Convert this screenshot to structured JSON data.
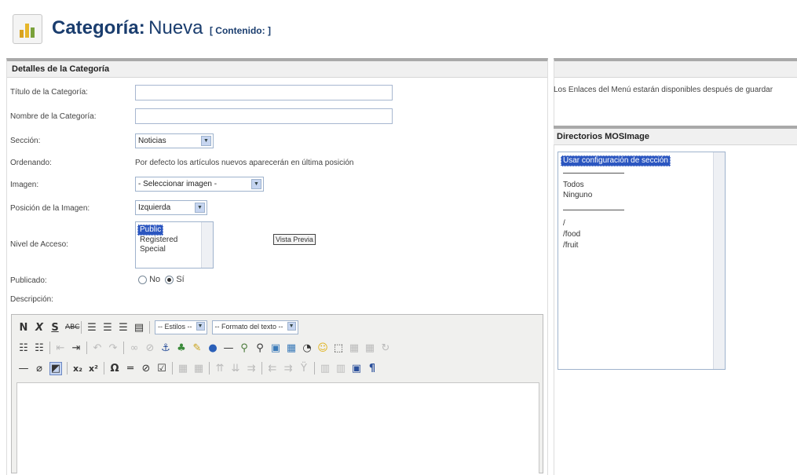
{
  "header": {
    "title_bold": "Categoría:",
    "title_rest": "Nueva",
    "title_context": "[ Contenido: ]",
    "icon": "folder-category-icon"
  },
  "details": {
    "heading": "Detalles de la Categoría",
    "titulo_label": "Título de la Categoría:",
    "titulo_value": "",
    "nombre_label": "Nombre de la Categoría:",
    "nombre_value": "",
    "seccion_label": "Sección:",
    "seccion_value": "Noticias",
    "ordenando_label": "Ordenando:",
    "ordenando_value": "Por defecto los artículos nuevos aparecerán en última posición",
    "imagen_label": "Imagen:",
    "imagen_value": "- Seleccionar imagen -",
    "posicion_label": "Posición de la Imagen:",
    "posicion_value": "Izquierda",
    "nivel_label": "Nivel de Acceso:",
    "nivel_options": [
      "Public",
      "Registered",
      "Special"
    ],
    "nivel_selected": "Public",
    "vista_previa": "Vista Previa",
    "publicado_label": "Publicado:",
    "publicado_no": "No",
    "publicado_si": "Sí",
    "publicado_value": "Sí",
    "descripcion_label": "Descripción:"
  },
  "editor": {
    "estilos": "-- Estilos --",
    "formato": "-- Formato del texto --",
    "row1": [
      "bold-icon",
      "italic-icon",
      "underline-icon",
      "strikethrough-icon",
      "align-left-icon",
      "align-center-icon",
      "align-right-icon",
      "align-justify-icon"
    ],
    "row2_icons": [
      "bullet-list-icon",
      "numbered-list-icon",
      "outdent-icon",
      "indent-icon",
      "undo-icon",
      "redo-icon",
      "link-icon",
      "unlink-icon",
      "anchor-icon",
      "image-icon",
      "cleanup-icon",
      "help-icon",
      "horizontal-rule-icon",
      "find-icon",
      "replace-icon",
      "media-icon",
      "paste-icon",
      "emoticon-icon",
      "smiley-icon",
      "visual-aid-icon",
      "insert-row-icon",
      "delete-row-icon",
      "redo-alt-icon"
    ],
    "row3_icons": [
      "hr-icon",
      "remove-format-icon",
      "visual-aid-icon",
      "subscript-icon",
      "superscript-icon",
      "special-char-icon",
      "insert-line-icon",
      "insert-image-icon",
      "insert-date-icon",
      "table-icon",
      "table-props-icon",
      "row-before-icon",
      "row-after-icon",
      "delete-row-icon",
      "col-before-icon",
      "col-after-icon",
      "delete-col-icon",
      "split-cells-icon",
      "merge-cells-icon",
      "fullscreen-icon",
      "ltr-icon"
    ]
  },
  "right": {
    "menu_note": "Los Enlaces del Menú estarán disponibles después de guardar",
    "mos_heading": "Directorios MOSImage",
    "mos_selected": "Usar configuración de sección",
    "mos_options_group1": [
      "Todos",
      "Ninguno"
    ],
    "mos_options_group2": [
      "/",
      "/food",
      "/fruit"
    ]
  },
  "colors": {
    "title_blue": "#1a3d6e",
    "selection_blue": "#2b56c0",
    "panel_header_gray": "#f0f0f0"
  }
}
